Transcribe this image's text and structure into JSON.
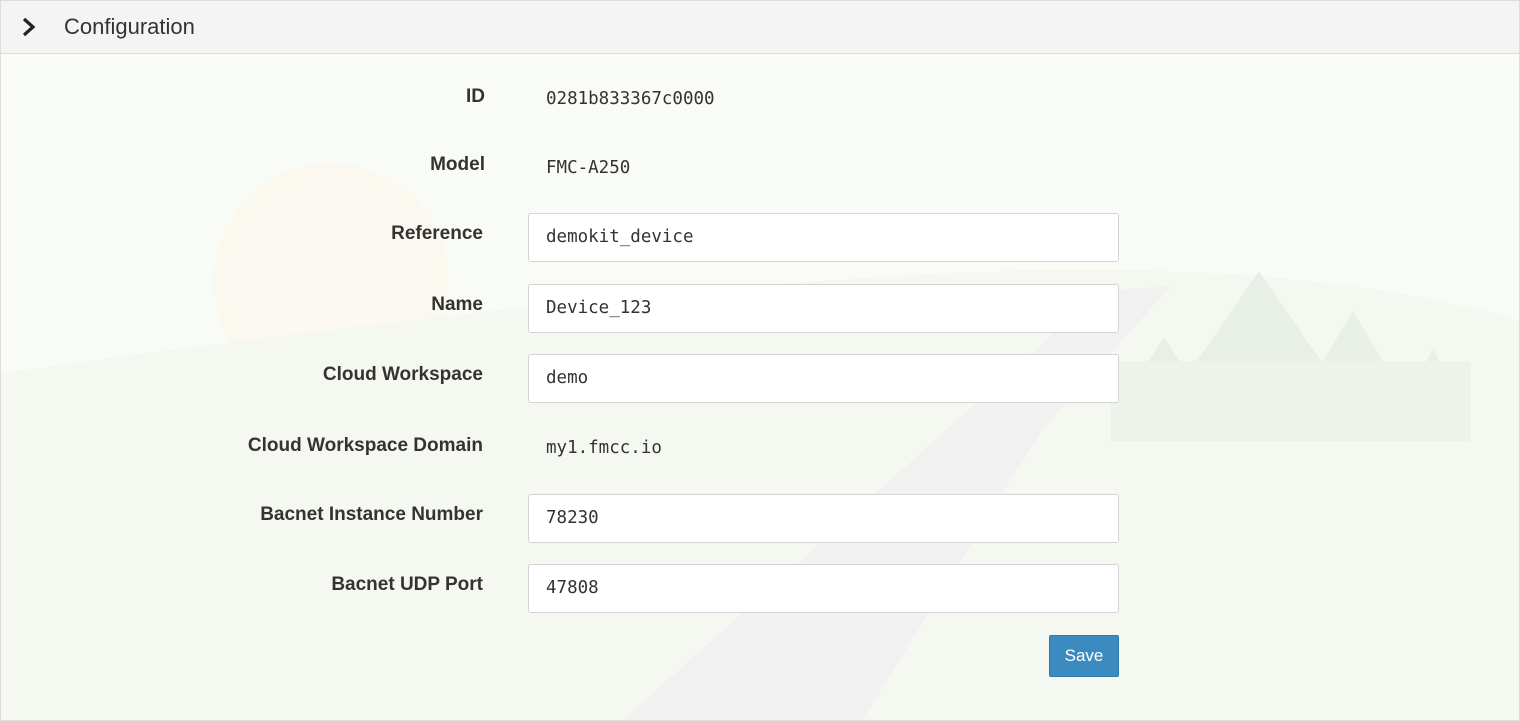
{
  "header": {
    "title": "Configuration",
    "toggle_icon": "chevron-right-icon"
  },
  "fields": {
    "id": {
      "label": "ID",
      "value": "0281b833367c0000"
    },
    "model": {
      "label": "Model",
      "value": "FMC-A250"
    },
    "reference": {
      "label": "Reference",
      "value": "demokit_device"
    },
    "name": {
      "label": "Name",
      "value": "Device_123"
    },
    "cloud_workspace": {
      "label": "Cloud Workspace",
      "value": "demo"
    },
    "cloud_workspace_domain": {
      "label": "Cloud Workspace Domain",
      "value": "my1.fmcc.io"
    },
    "bacnet_instance": {
      "label": "Bacnet Instance Number",
      "value": "78230"
    },
    "bacnet_udp_port": {
      "label": "Bacnet UDP Port",
      "value": "47808"
    }
  },
  "actions": {
    "save_label": "Save"
  },
  "colors": {
    "primary": "#3b8bc0",
    "header_bg": "#f4f4f4"
  }
}
